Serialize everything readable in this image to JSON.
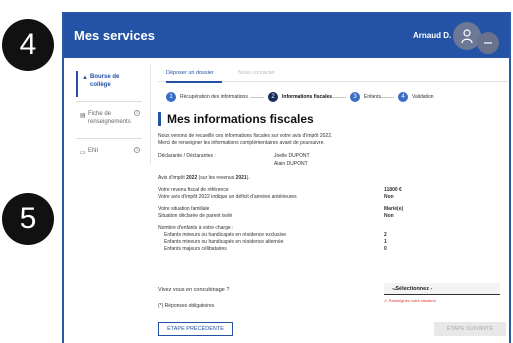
{
  "callouts": {
    "first": "4",
    "second": "5"
  },
  "header": {
    "title": "Mes services",
    "user": "Arnaud D."
  },
  "sidebar": {
    "items": [
      {
        "label": "Bourse de collège",
        "icon": "graduation-icon"
      },
      {
        "label": "Fiche de renseignements",
        "icon": "document-icon"
      },
      {
        "label": "ENI",
        "icon": "card-icon"
      }
    ]
  },
  "tabs": {
    "deposit": "Déposer un dossier",
    "contact": "Nous contacter"
  },
  "stepper": [
    {
      "num": "1",
      "label": "Récupération des informations"
    },
    {
      "num": "2",
      "label": "Informations fiscales"
    },
    {
      "num": "3",
      "label": "Enfants"
    },
    {
      "num": "4",
      "label": "Validation"
    }
  ],
  "main": {
    "title": "Mes informations fiscales",
    "intro1": "Nous venons de recueillir ces informations fiscales sur votre avis d'impôt 2022.",
    "intro2": "Merci de renseigner les informations complémentaires avant de poursuivre.",
    "declarants_label": "Déclarante / Déclarantes :",
    "declarant1": "Joelle DUPONT",
    "declarant2": "Alain DUPONT",
    "avis_prefix": "Avis d'impôt ",
    "avis_year": "2022",
    "avis_mid": " (sur les revenus ",
    "avis_rev": "2021",
    "avis_suffix": ").",
    "rows": [
      {
        "k": "Votre revenu fiscal de référence",
        "v": "11800 €"
      },
      {
        "k": "Votre avis d'impôt 2022 indique un déficit d'années antérieures",
        "v": "Non"
      }
    ],
    "rows2": [
      {
        "k": "Votre situation familiale",
        "v": "Marié(e)"
      },
      {
        "k": "Situation déclarée de parent isolé",
        "v": "Non"
      }
    ],
    "children_heading": "Nombre d'enfants à votre charge :",
    "rows3": [
      {
        "k": "Enfants mineurs ou handicapés en résidence exclusive",
        "v": "2"
      },
      {
        "k": "Enfants mineurs ou handicapés en résidence alternée",
        "v": "1"
      },
      {
        "k": "Enfants majeurs célibataires",
        "v": "0"
      }
    ],
    "concubinage_question": "Vivez vous en concubinage ?",
    "select_value": "- Sélectionnez -",
    "select_error": "Renseignez votre situation",
    "required_note": "(*) Réponses obligatoires"
  },
  "buttons": {
    "prev": "ÉTAPE PRÉCÉDENTE",
    "next": "ÉTAPE SUIVANTE"
  }
}
